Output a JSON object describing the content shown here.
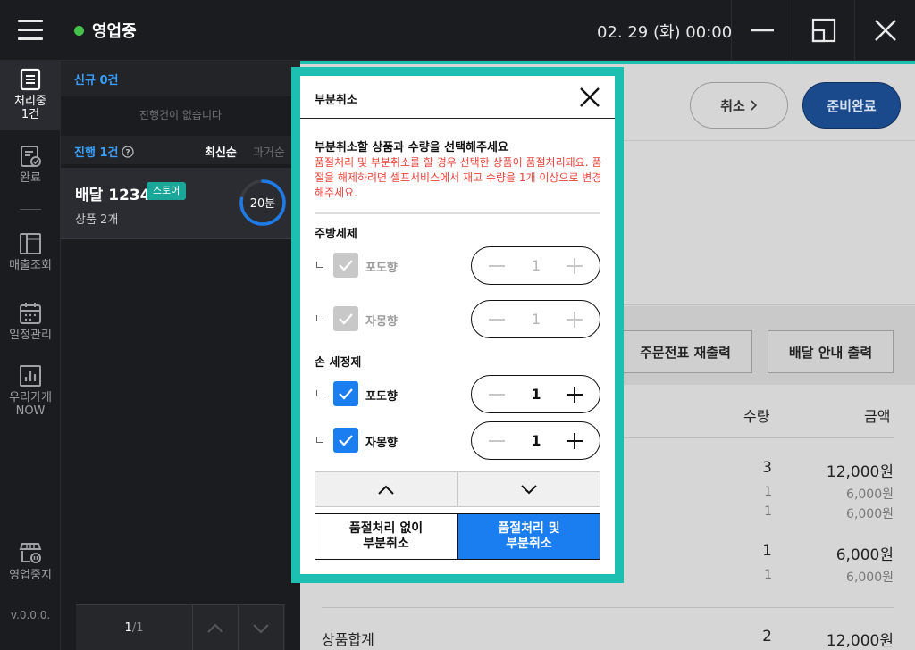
{
  "topbar": {
    "status": "영업중",
    "datetime": "02. 29 (화) 00:00"
  },
  "nav": {
    "processing": "처리중",
    "processing_count": "1건",
    "done": "완료",
    "sales": "매출조회",
    "schedule": "일정관리",
    "store_now_1": "우리가게",
    "store_now_2": "NOW",
    "pause": "영업중지",
    "version": "v.0.0.0."
  },
  "orders": {
    "new_header": "신규 0건",
    "empty": "진행건이 없습니다",
    "progress_header": "진행 1건",
    "sort_latest": "최신순",
    "sort_oldest": "과거순",
    "card": {
      "title": "배달 1234",
      "badge": "스토어",
      "sub": "상품 2개",
      "timer": "20분",
      "timer_progress": 0.78
    },
    "pager": {
      "current": "1",
      "total": "/1"
    }
  },
  "content": {
    "cancel_btn": "취소",
    "ready_btn": "준비완료",
    "reprint_btn": "주문전표 재출력",
    "delivery_print_btn": "배달 안내 출력",
    "col_qty": "수량",
    "col_amount": "금액",
    "rows": [
      {
        "qty": "3",
        "amount": "12,000원"
      },
      {
        "qty": "1",
        "amount": "6,000원"
      },
      {
        "qty": "1",
        "amount": "6,000원"
      },
      {
        "qty": "1",
        "amount": "6,000원"
      },
      {
        "qty": "1",
        "amount": "6,000원"
      }
    ],
    "sum_label": "상품합계",
    "sum_qty": "2",
    "sum_amount": "12,000원"
  },
  "modal": {
    "title": "부분취소",
    "desc_title": "부분취소할 상품과 수량을 선택해주세요",
    "desc_warn": "품절처리 및 부분취소를 할 경우 선택한 상품이 품절처리돼요. 품절을 해제하려면 셀프서비스에서 재고 수량을 1개 이상으로 변경해주세요.",
    "groups": [
      {
        "label": "주방세제",
        "items": [
          {
            "name": "포도향",
            "qty": "1"
          },
          {
            "name": "자몽향",
            "qty": "1"
          }
        ]
      },
      {
        "label": "손 세정제",
        "items": [
          {
            "name": "포도향",
            "qty": "1"
          },
          {
            "name": "자몽향",
            "qty": "1"
          }
        ]
      }
    ],
    "btn_no_soldout_1": "품절처리 없이",
    "btn_no_soldout_2": "부분취소",
    "btn_soldout_1": "품절처리 및",
    "btn_soldout_2": "부분취소"
  },
  "colors": {
    "accent_teal": "#1dbfb0",
    "primary_blue": "#1a7ef0",
    "status_green": "#43c24b",
    "warn_red": "#e8453c"
  }
}
